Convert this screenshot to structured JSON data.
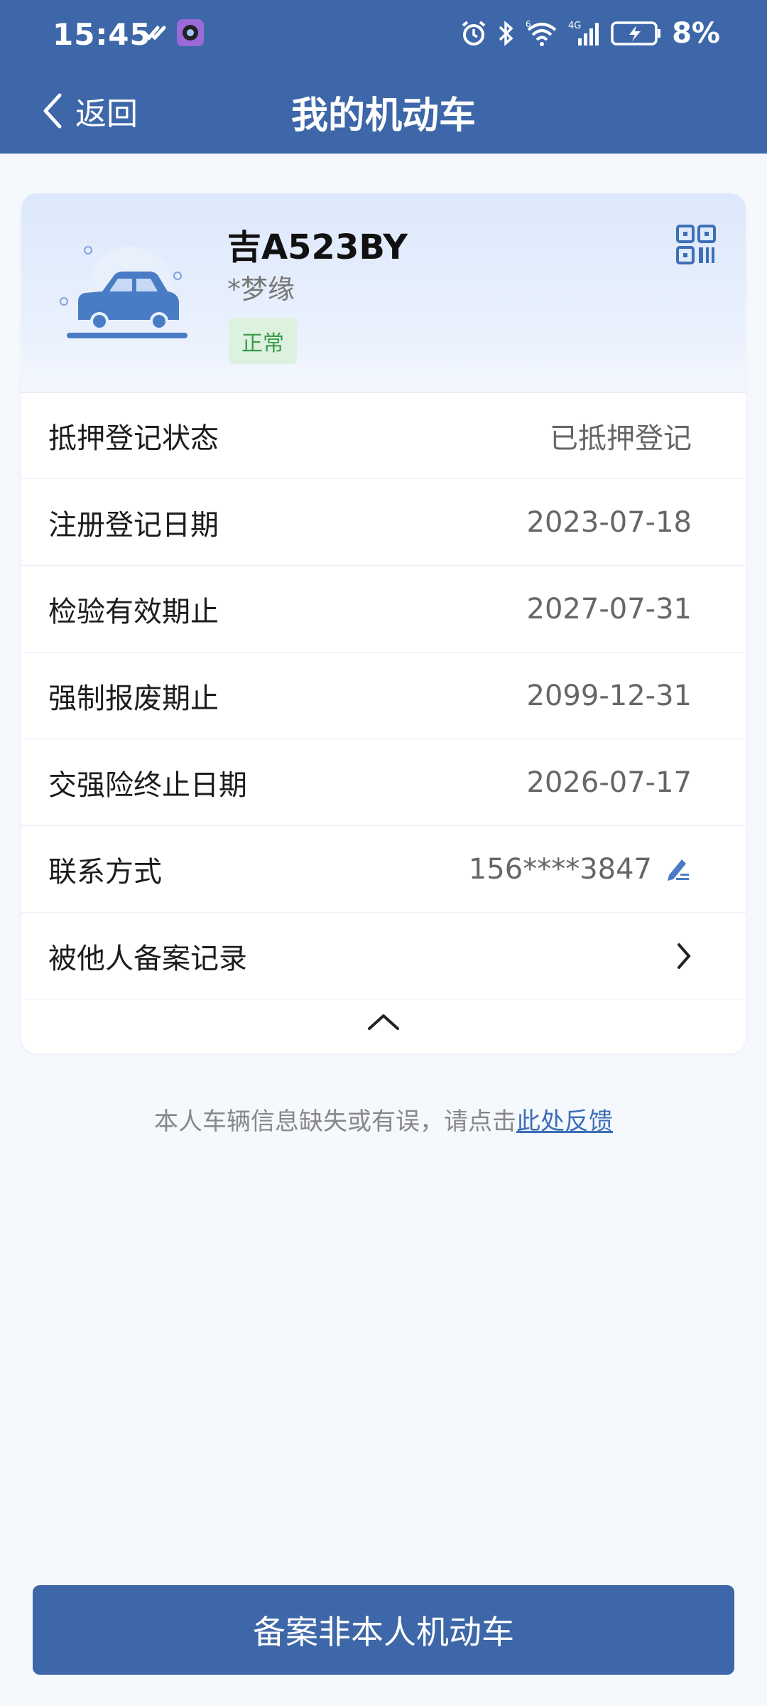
{
  "status_bar": {
    "time": "15:45",
    "battery": "8%",
    "left_icons": [
      "check-double-icon",
      "camera-app-icon"
    ],
    "right_icons": [
      "alarm-icon",
      "bluetooth-icon",
      "wifi-icon",
      "signal-4g-icon",
      "battery-charging-icon"
    ],
    "wifi_label": "6",
    "net_label": "4G"
  },
  "nav": {
    "back_label": "返回",
    "title": "我的机动车"
  },
  "vehicle": {
    "plate": "吉A523BY",
    "owner": "*梦缘",
    "status": "正常",
    "status_color": "#3a9a4a"
  },
  "rows": [
    {
      "label": "抵押登记状态",
      "value": "已抵押登记"
    },
    {
      "label": "注册登记日期",
      "value": "2023-07-18"
    },
    {
      "label": "检验有效期止",
      "value": "2027-07-31"
    },
    {
      "label": "强制报废期止",
      "value": "2099-12-31"
    },
    {
      "label": "交强险终止日期",
      "value": "2026-07-17"
    },
    {
      "label": "联系方式",
      "value": "156****3847"
    },
    {
      "label": "被他人备案记录",
      "value": ""
    }
  ],
  "feedback": {
    "text": "本人车辆信息缺失或有误，请点击",
    "link": "此处反馈"
  },
  "primary_button": "备案非本人机动车",
  "colors": {
    "brand": "#3d67a8",
    "link": "#3c6fb6",
    "background": "#f5f8fd"
  }
}
